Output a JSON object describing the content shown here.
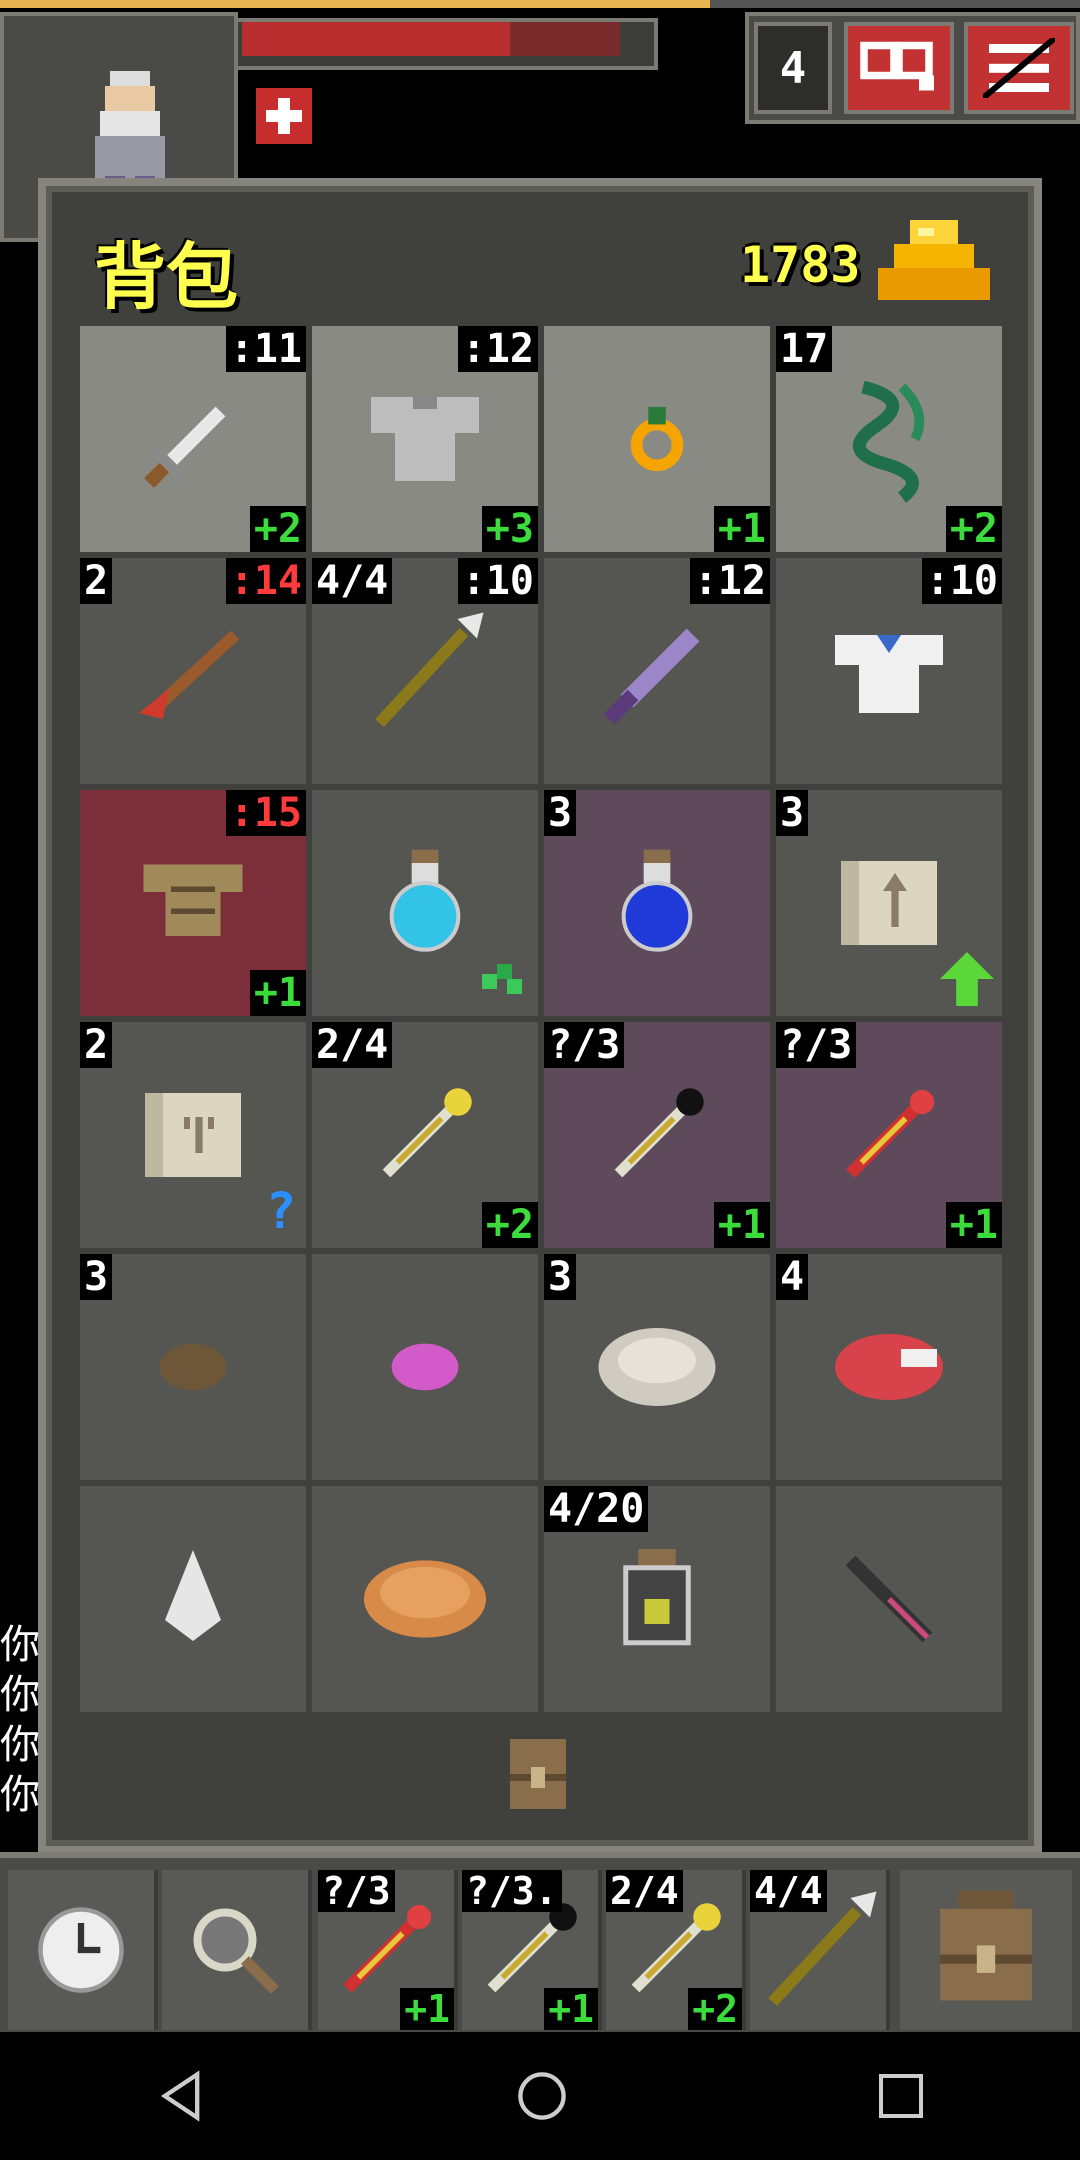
{
  "hud": {
    "depth": "4"
  },
  "bag": {
    "title": "背包",
    "gold": "1783",
    "rows": [
      [
        {
          "icon": "short-sword",
          "lvl": ":11",
          "lvl_warn": false,
          "ench": "+2",
          "bg": "light"
        },
        {
          "icon": "chain-armor",
          "lvl": ":12",
          "lvl_warn": false,
          "ench": "+3",
          "bg": "light"
        },
        {
          "icon": "ring",
          "ench": "+1",
          "bg": "light"
        },
        {
          "icon": "whip",
          "qty": "17",
          "ench": "+2",
          "bg": "light"
        }
      ],
      [
        {
          "icon": "darts",
          "qty": "2",
          "lvl": ":14",
          "lvl_warn": true
        },
        {
          "icon": "spear",
          "qty": "4/4",
          "lvl": ":10",
          "lvl_warn": false
        },
        {
          "icon": "purple-sword",
          "lvl": ":12",
          "lvl_warn": false
        },
        {
          "icon": "cloth-shirt",
          "lvl": ":10",
          "lvl_warn": false
        }
      ],
      [
        {
          "icon": "leather-armor",
          "lvl": ":15",
          "lvl_warn": true,
          "ench": "+1",
          "bg": "red"
        },
        {
          "icon": "cyan-potion",
          "sparkle": true
        },
        {
          "icon": "blue-potion",
          "qty": "3",
          "bg": "purple"
        },
        {
          "icon": "scroll-upgrade",
          "qty": "3",
          "uparrow": true
        }
      ],
      [
        {
          "icon": "scroll-unknown",
          "qty": "2",
          "qmark": "?"
        },
        {
          "icon": "wand-gold",
          "qty": "2/4",
          "ench": "+2"
        },
        {
          "icon": "wand-black",
          "qty": "?/3",
          "ench": "+1",
          "bg": "purple"
        },
        {
          "icon": "wand-red",
          "qty": "?/3",
          "ench": "+1",
          "bg": "purple"
        }
      ],
      [
        {
          "icon": "seed",
          "qty": "3"
        },
        {
          "icon": "pink-stone"
        },
        {
          "icon": "bandage",
          "qty": "3"
        },
        {
          "icon": "meat",
          "qty": "4"
        }
      ],
      [
        {
          "icon": "water-drop"
        },
        {
          "icon": "pasty"
        },
        {
          "icon": "dew-vial",
          "qty": "4/20"
        },
        {
          "icon": "dark-dagger"
        }
      ]
    ]
  },
  "chat": [
    "你",
    "你",
    "你",
    "你"
  ],
  "toolbar": {
    "quickslots": [
      {
        "icon": "wand-red",
        "qty": "?/3",
        "ench": "+1"
      },
      {
        "icon": "wand-black",
        "qty": "?/3.",
        "ench": "+1"
      },
      {
        "icon": "wand-gold",
        "qty": "2/4",
        "ench": "+2"
      },
      {
        "icon": "spear",
        "qty": "4/4"
      }
    ]
  }
}
